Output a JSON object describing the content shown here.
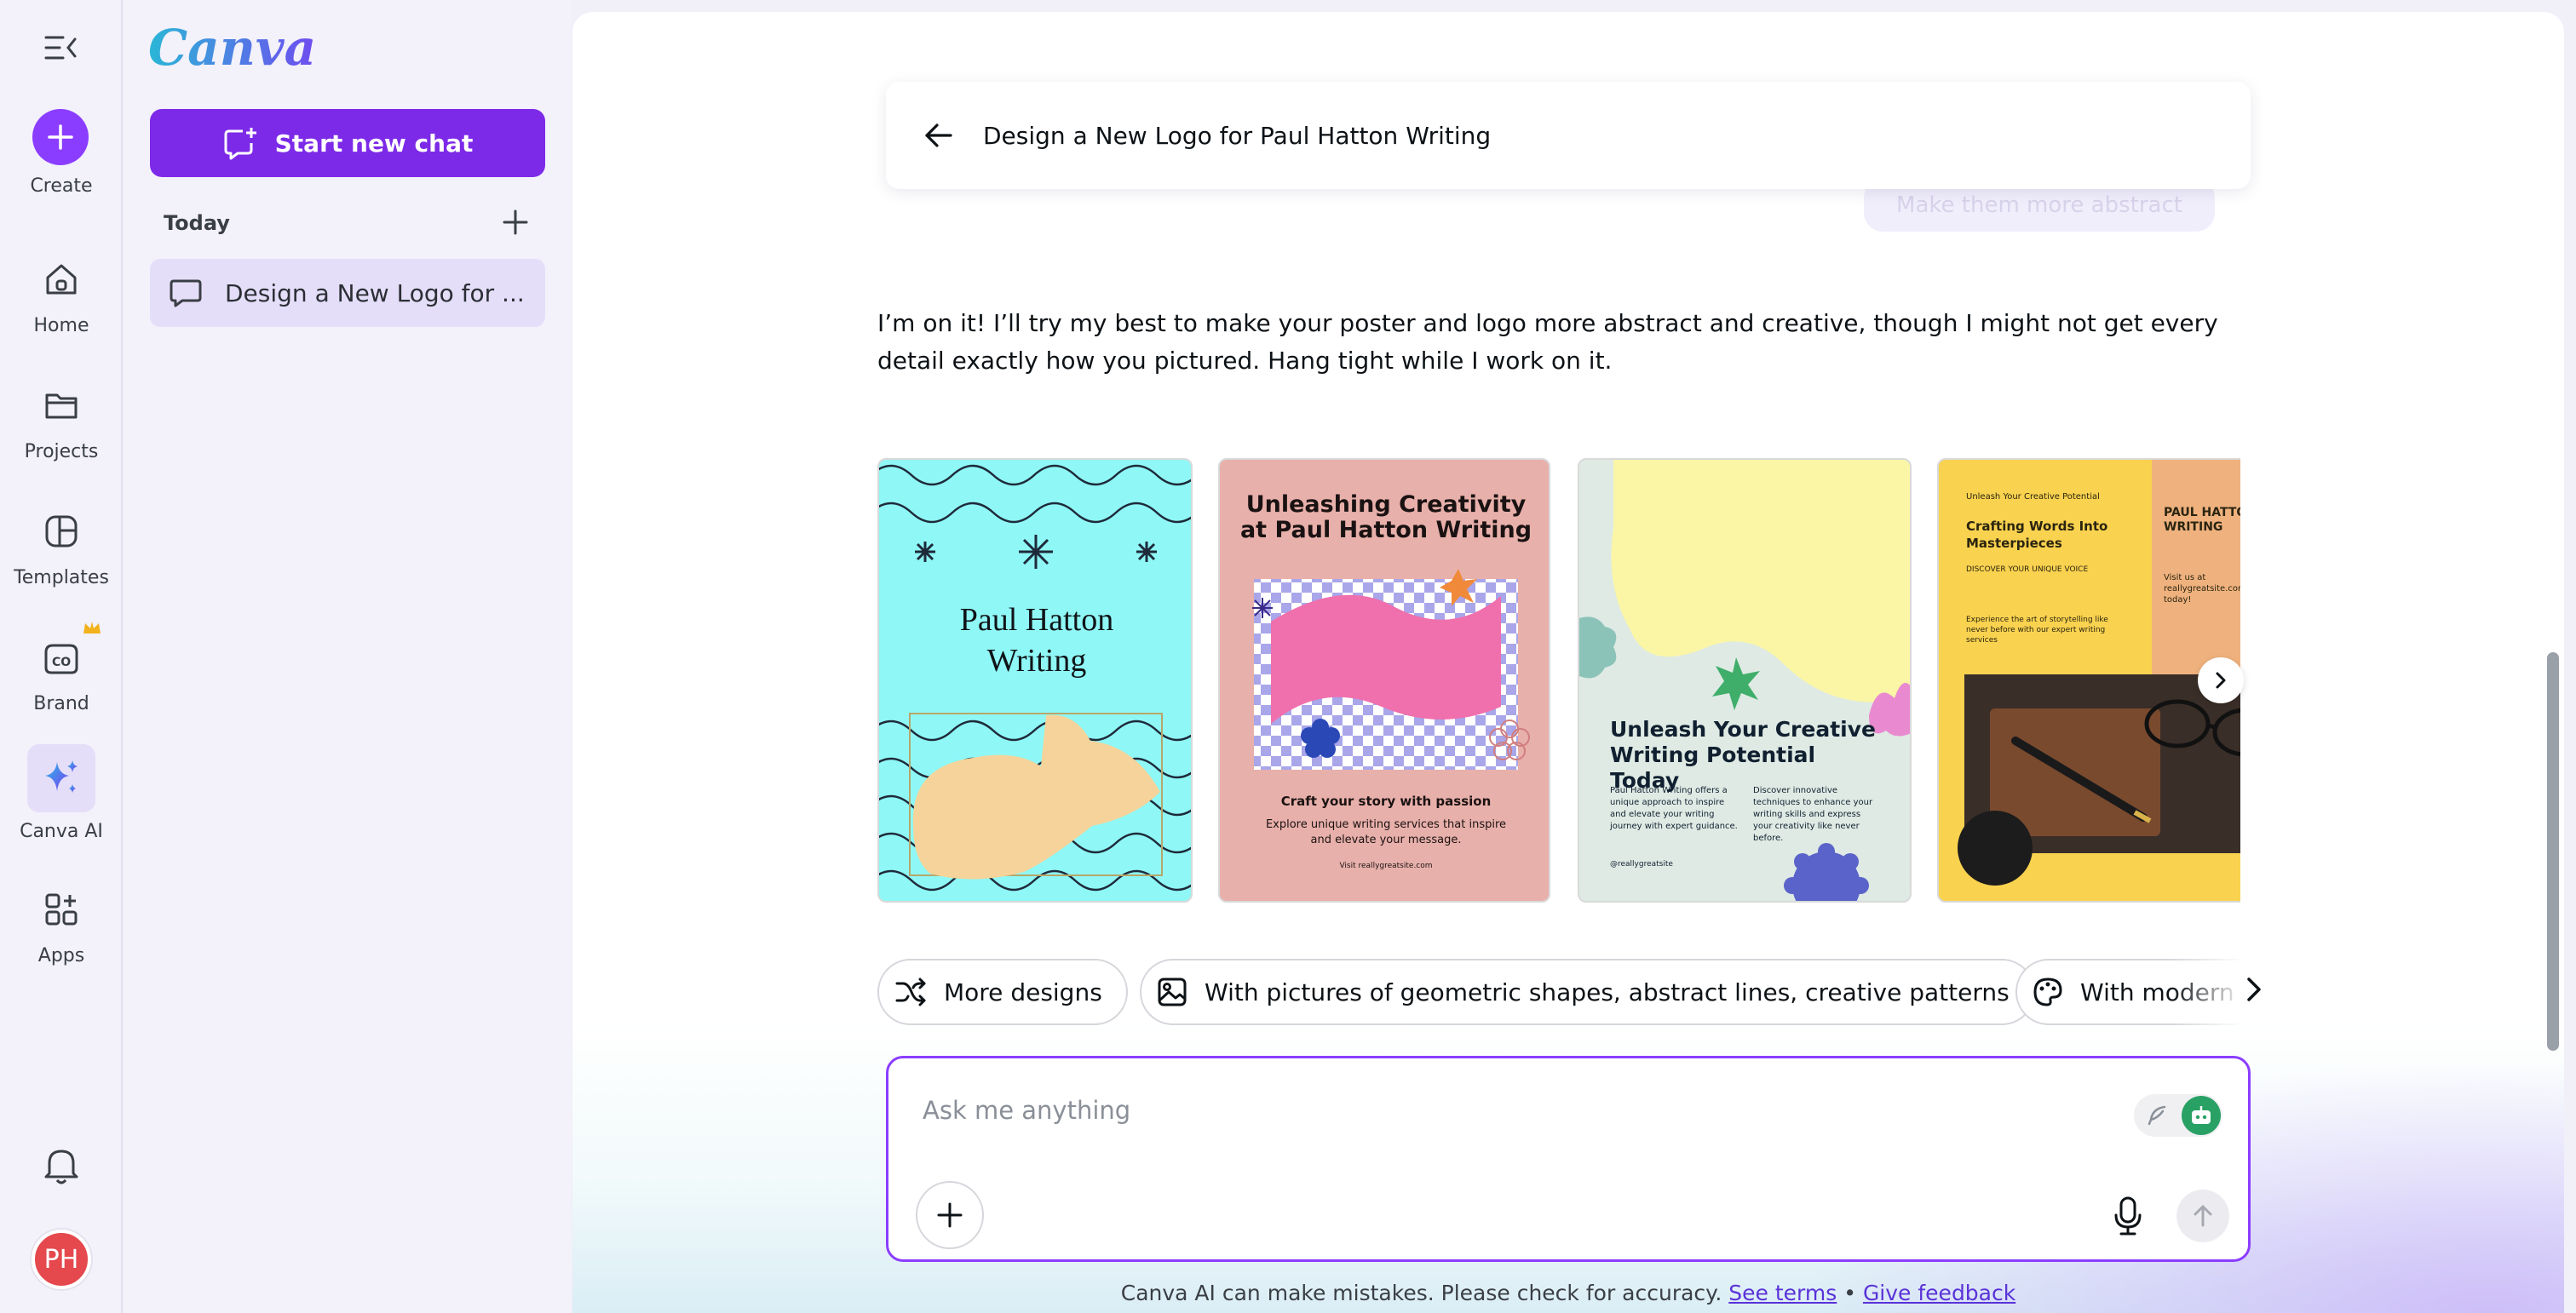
{
  "rail": {
    "create_label": "Create",
    "items": [
      {
        "label": "Home",
        "icon": "home-icon"
      },
      {
        "label": "Projects",
        "icon": "folder-icon"
      },
      {
        "label": "Templates",
        "icon": "templates-icon"
      },
      {
        "label": "Brand",
        "icon": "brand-icon"
      },
      {
        "label": "Canva AI",
        "icon": "sparkle-icon"
      },
      {
        "label": "Apps",
        "icon": "apps-icon"
      }
    ],
    "avatar_initials": "PH"
  },
  "side": {
    "logo": "Canva",
    "new_chat_label": "Start new chat",
    "section_today": "Today",
    "chats": [
      {
        "title": "Design a New Logo for ..."
      }
    ]
  },
  "main": {
    "chat_title": "Design a New Logo for Paul Hatton Writing",
    "previous_bubble": "Make them more abstract",
    "reply": "I’m on it! I’ll try my best to make your poster and logo more abstract and creative, though I might not get every detail exactly how you pictured. Hang tight while I work on it.",
    "cards": [
      {
        "title_line1": "Paul Hatton",
        "title_line2": "Writing"
      },
      {
        "title_line1": "Unleashing Creativity",
        "title_line2": "at Paul Hatton Writing",
        "tagline": "Craft your story with passion",
        "body": "Explore unique writing services that inspire and elevate your message.",
        "url": "Visit reallygreatsite.com"
      },
      {
        "title_line1": "Unleash Your Creative",
        "title_line2": "Writing Potential Today",
        "col1": "Paul Hatton Writing offers a unique approach to inspire and elevate your writing journey with expert guidance.",
        "col2": "Discover innovative techniques to enhance your writing skills and express your creativity like never before.",
        "handle": "@reallygreatsite"
      },
      {
        "kicker": "Unleash Your Creative Potential",
        "title": "Crafting Words Into Masterpieces",
        "sub": "DISCOVER YOUR UNIQUE VOICE",
        "body": "Experience the art of storytelling like never before with our expert writing services",
        "side_title": "PAUL HATTON WRITING",
        "side_body": "Visit us at reallygreatsite.com today!"
      }
    ],
    "chips": [
      {
        "label": "More designs",
        "icon": "shuffle-icon"
      },
      {
        "label": "With pictures of geometric shapes, abstract lines, creative patterns",
        "icon": "image-icon"
      },
      {
        "label": "With modern colors",
        "icon": "palette-icon"
      }
    ],
    "composer_placeholder": "Ask me anything",
    "disclaimer": "Canva AI can make mistakes. Please check for accuracy.",
    "see_terms": "See terms",
    "separator": "•",
    "give_feedback": "Give feedback"
  }
}
